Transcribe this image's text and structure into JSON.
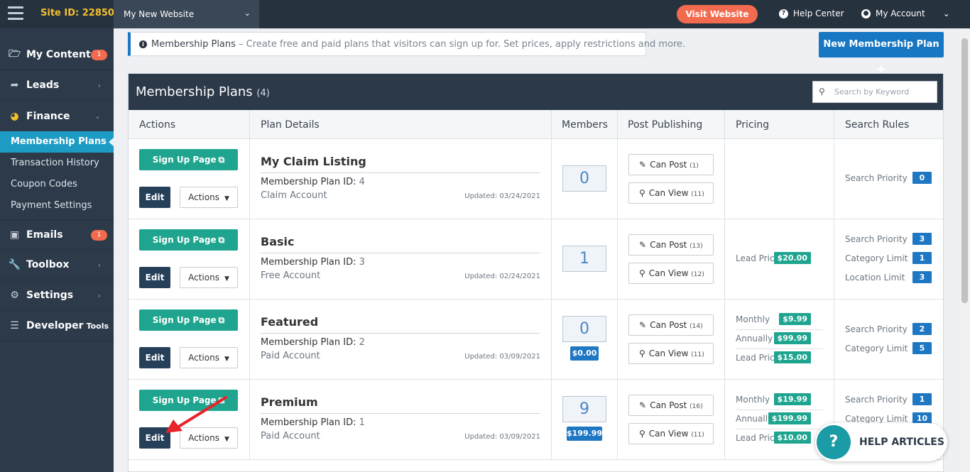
{
  "topbar": {
    "site_id": "Site ID: 22850",
    "site_selector": "My New Website",
    "visit_button": "Visit Website",
    "help_center": "Help Center",
    "my_account": "My Account"
  },
  "sidebar": {
    "items": [
      {
        "label": "My Content",
        "icon": "folder-icon",
        "badge": "1"
      },
      {
        "label": "Leads",
        "icon": "share-icon"
      },
      {
        "label": "Finance",
        "icon": "pie-chart-icon"
      },
      {
        "label": "Emails",
        "icon": "inbox-icon",
        "badge": "1"
      },
      {
        "label": "Toolbox",
        "icon": "wrench-icon"
      },
      {
        "label": "Settings",
        "icon": "gear-icon"
      },
      {
        "label": "Developer",
        "suffix": "Tools",
        "icon": "sliders-icon"
      }
    ],
    "finance_sub": [
      {
        "label": "Membership Plans",
        "active": true
      },
      {
        "label": "Transaction History"
      },
      {
        "label": "Coupon Codes"
      },
      {
        "label": "Payment Settings"
      }
    ]
  },
  "info_bar": {
    "title": "Membership Plans",
    "description": " – Create free and paid plans that visitors can sign up for. Set prices, apply restrictions and more."
  },
  "new_plan_button": "New Membership Plan",
  "panel": {
    "title": "Membership Plans",
    "count": "(4)",
    "search_placeholder": "Search by Keyword",
    "columns": [
      "Actions",
      "Plan Details",
      "Members",
      "Post Publishing",
      "Pricing",
      "Search Rules"
    ]
  },
  "row_labels": {
    "signup": "Sign Up Page",
    "edit": "Edit",
    "actions": "Actions",
    "plan_id_prefix": "Membership Plan ID: ",
    "can_post": "Can Post",
    "can_view": "Can View"
  },
  "plans": [
    {
      "name": "My Claim Listing",
      "id": "4",
      "account": "Claim Account",
      "updated": "Updated: 03/24/2021",
      "members": "0",
      "member_price": "",
      "can_post": "(1)",
      "can_view": "(11)",
      "pricing": [],
      "search_rules": [
        {
          "label": "Search Priority",
          "value": "0"
        }
      ]
    },
    {
      "name": "Basic",
      "id": "3",
      "account": "Free Account",
      "updated": "Updated: 02/24/2021",
      "members": "1",
      "member_price": "",
      "can_post": "(13)",
      "can_view": "(12)",
      "pricing": [
        {
          "label": "Lead Price",
          "value": "$20.00"
        }
      ],
      "search_rules": [
        {
          "label": "Search Priority",
          "value": "3"
        },
        {
          "label": "Category Limit",
          "value": "1"
        },
        {
          "label": "Location Limit",
          "value": "3"
        }
      ]
    },
    {
      "name": "Featured",
      "id": "2",
      "account": "Paid Account",
      "updated": "Updated: 03/09/2021",
      "members": "0",
      "member_price": "$0.00",
      "can_post": "(14)",
      "can_view": "(11)",
      "pricing": [
        {
          "label": "Monthly",
          "value": "$9.99"
        },
        {
          "label": "Annually",
          "value": "$99.99"
        },
        {
          "label": "Lead Price",
          "value": "$15.00"
        }
      ],
      "search_rules": [
        {
          "label": "Search Priority",
          "value": "2"
        },
        {
          "label": "Category Limit",
          "value": "5"
        }
      ]
    },
    {
      "name": "Premium",
      "id": "1",
      "account": "Paid Account",
      "updated": "Updated: 03/09/2021",
      "members": "9",
      "member_price": "$199.99",
      "can_post": "(16)",
      "can_view": "(11)",
      "pricing": [
        {
          "label": "Monthly",
          "value": "$19.99"
        },
        {
          "label": "Annually",
          "value": "$199.99"
        },
        {
          "label": "Lead Price",
          "value": "$10.00"
        }
      ],
      "search_rules": [
        {
          "label": "Search Priority",
          "value": "1"
        },
        {
          "label": "Category Limit",
          "value": "10"
        }
      ]
    }
  ],
  "help_articles": "HELP ARTICLES",
  "colors": {
    "accent": "#1d77c2",
    "green": "#1fa58f",
    "orange": "#f26b4f",
    "dark": "#2b3949",
    "annotation_arrow": "#e8232a"
  }
}
